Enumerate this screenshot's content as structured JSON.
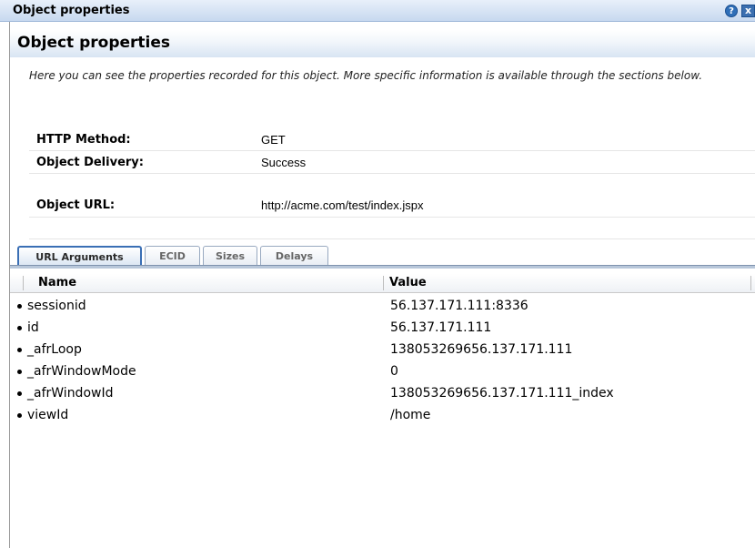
{
  "window": {
    "title": "Object properties",
    "help_glyph": "?",
    "close_glyph": "x"
  },
  "section": {
    "title": "Object properties",
    "intro": "Here you can see the properties recorded for this object. More specific information is available through the sections below."
  },
  "properties": {
    "http_method_label": "HTTP Method:",
    "http_method_value": "GET",
    "delivery_label": "Object Delivery:",
    "delivery_value": "Success",
    "url_label": "Object URL:",
    "url_value": "http://acme.com/test/index.jspx"
  },
  "tabs": [
    {
      "label": "URL Arguments",
      "active": true
    },
    {
      "label": "ECID",
      "active": false
    },
    {
      "label": "Sizes",
      "active": false
    },
    {
      "label": "Delays",
      "active": false
    }
  ],
  "table": {
    "columns": [
      "Name",
      "Value"
    ],
    "rows": [
      {
        "name": "sessionid",
        "value": "56.137.171.111:8336"
      },
      {
        "name": "id",
        "value": "56.137.171.111"
      },
      {
        "name": "_afrLoop",
        "value": "138053269656.137.171.111"
      },
      {
        "name": "_afrWindowMode",
        "value": "0"
      },
      {
        "name": "_afrWindowId",
        "value": "138053269656.137.171.111_index"
      },
      {
        "name": "viewId",
        "value": "/home"
      }
    ]
  },
  "icons": {
    "help": "help-icon",
    "close": "close-icon"
  }
}
